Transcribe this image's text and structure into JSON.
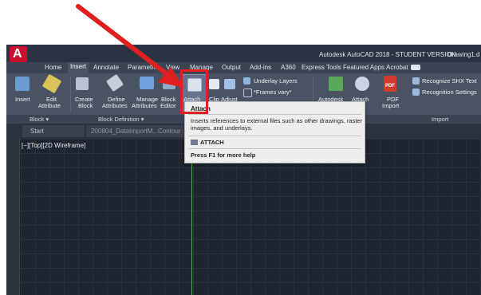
{
  "titlebar": {
    "app_letter": "A",
    "title_text": "Autodesk AutoCAD 2018 - STUDENT VERSION",
    "doc_name": "Drawing1.d"
  },
  "tabs": [
    "Home",
    "Insert",
    "Annotate",
    "Parametric",
    "View",
    "Manage",
    "Output",
    "Add-ins",
    "A360",
    "Express Tools",
    "Featured Apps",
    "Acrobat"
  ],
  "active_tab": "Insert",
  "ribbon": {
    "insert": "Insert",
    "edit_attribute": [
      "Edit",
      "Attribute"
    ],
    "create_block": [
      "Create",
      "Block"
    ],
    "define_attributes": [
      "Define",
      "Attributes"
    ],
    "manage_attributes": [
      "Manage",
      "Attributes"
    ],
    "block_editor": [
      "Block",
      "Editor"
    ],
    "attach": "Attach",
    "clip": "Clip",
    "adjust": "Adjust",
    "underlay_layers": "Underlay Layers",
    "frames_vary": "*Frames vary*",
    "autodesk": "Autodesk",
    "attach2": "Attach",
    "pdf_import": [
      "PDF",
      "Import"
    ],
    "recognize_shx": "Recognize SHX Text",
    "recognition_settings": "Recognition Settings",
    "pdf_badge": "PDF"
  },
  "panels": {
    "block": "Block ▾",
    "block_definition": "Block Definition ▾",
    "import": "Import"
  },
  "doc_tabs": {
    "start": "Start",
    "file": "200804_DataImportM...Contour"
  },
  "viewport_label": "[−][Top][2D Wireframe]",
  "tooltip": {
    "title": "Attach",
    "desc_line1": "Inserts references to external files such as other drawings, raster",
    "desc_line2": "images, and underlays.",
    "command": "ATTACH",
    "help": "Press F1 for more help"
  },
  "colors": {
    "annotation_red": "#e02020",
    "cursor_green": "#3fbf3f",
    "logo_red": "#c8102e"
  }
}
